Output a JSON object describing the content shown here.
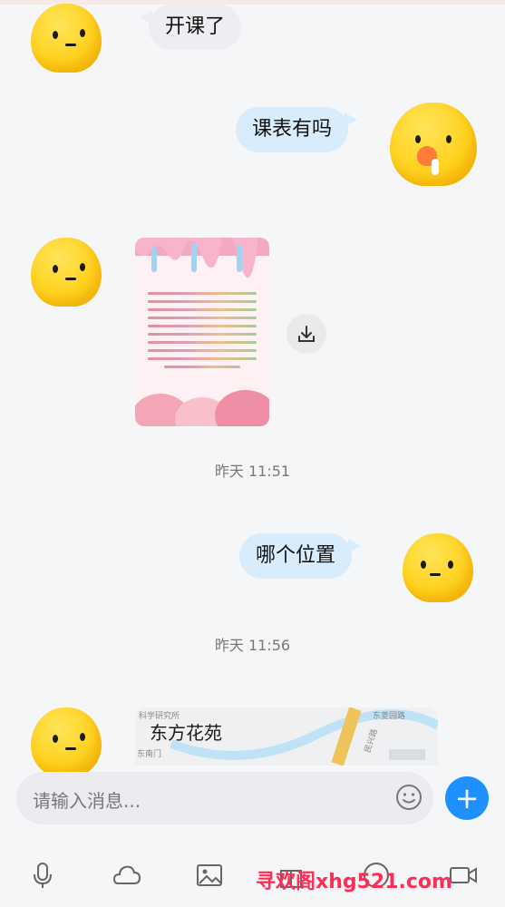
{
  "messages": [
    {
      "side": "left",
      "text": "开课了"
    },
    {
      "side": "right",
      "text": "课表有吗"
    },
    {
      "side": "left",
      "type": "image"
    },
    {
      "side": "right",
      "text": "哪个位置"
    },
    {
      "side": "left",
      "type": "location",
      "title": "东方花苑"
    }
  ],
  "timestamps": [
    "昨天 11:51",
    "昨天 11:56"
  ],
  "map_labels": [
    "科学研究所",
    "东南门",
    "东菱园路",
    "民兴路"
  ],
  "input": {
    "placeholder": "请输入消息..."
  },
  "add_button": {
    "label": "+"
  },
  "watermark": "寻欢阁xhg521.com",
  "colors": {
    "accent": "#1e90ff",
    "bubble_right": "#d9ecfb",
    "bubble_left": "#eceef1"
  },
  "toolbar_icons": [
    "microphone-icon",
    "cloud-icon",
    "image-icon",
    "gift-icon",
    "emoji-icon",
    "video-icon"
  ]
}
